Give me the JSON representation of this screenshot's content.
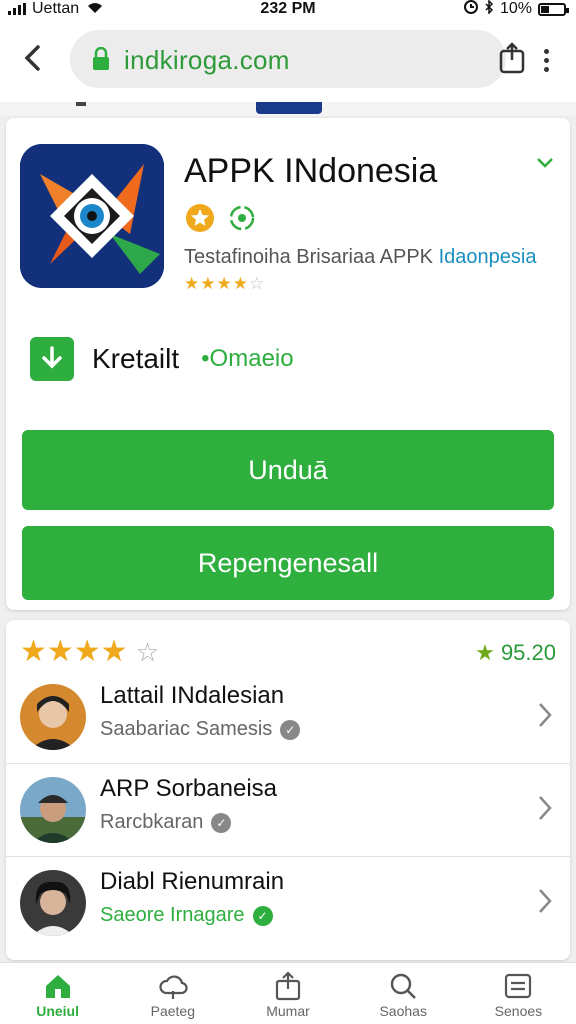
{
  "status_bar": {
    "carrier": "Uettan",
    "time": "232 PM",
    "battery": "10%"
  },
  "browser": {
    "url": "indkiroga.com"
  },
  "app": {
    "title": "APPK INdonesia",
    "subtitle": "Testafinoiha Brisariaa APPK",
    "subtitle_highlight": "Idaonpesia",
    "rating_stars": "★★★★",
    "rating_empty": "☆",
    "download_label": "Kretailt",
    "download_tag": "•Omaeio"
  },
  "buttons": {
    "download": "Unduā",
    "secondary": "Repengenesall"
  },
  "reviews": {
    "stars": "★★★★",
    "score": "95.20",
    "items": [
      {
        "name": "Lattail INdalesian",
        "sub": "Saabariac Samesis"
      },
      {
        "name": "ARP Sorbaneisa",
        "sub": "Rarcbkaran"
      },
      {
        "name": "Diabl Rienumrain",
        "sub": "Saeore Irnagare"
      }
    ]
  },
  "nav": [
    {
      "label": "Uneiul",
      "icon": "home-icon"
    },
    {
      "label": "Paeteg",
      "icon": "cloud-icon"
    },
    {
      "label": "Mumar",
      "icon": "share-icon"
    },
    {
      "label": "Saohas",
      "icon": "search-icon"
    },
    {
      "label": "Senoes",
      "icon": "list-icon"
    }
  ],
  "colors": {
    "accent": "#2eaf3e",
    "link": "#1a8fbf",
    "star": "#f0a81c"
  }
}
